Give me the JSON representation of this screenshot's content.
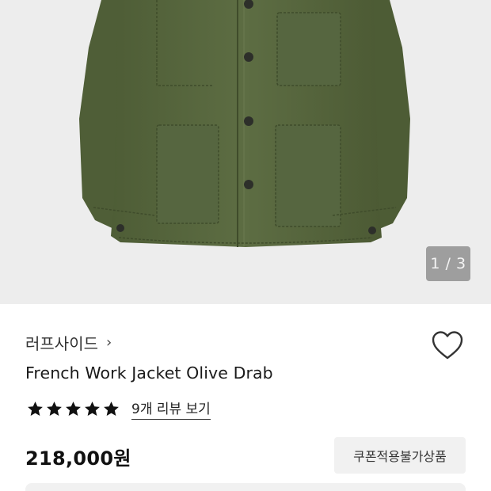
{
  "gallery": {
    "image_alt": "French Work Jacket Olive Drab product photo",
    "page_indicator": "1 / 3",
    "background_color": "#ededed",
    "jacket_color": "#5a6a40"
  },
  "product": {
    "brand": "러프사이드",
    "brand_chevron": "›",
    "title": "French Work Jacket Olive Drab",
    "rating_stars": 5,
    "review_link": "9개 리뷰 보기",
    "price": "218,000원",
    "coupon_badge": "쿠폰적용불가상품"
  },
  "icons": {
    "wishlist": "heart-outline-icon",
    "star": "star-filled-icon"
  }
}
